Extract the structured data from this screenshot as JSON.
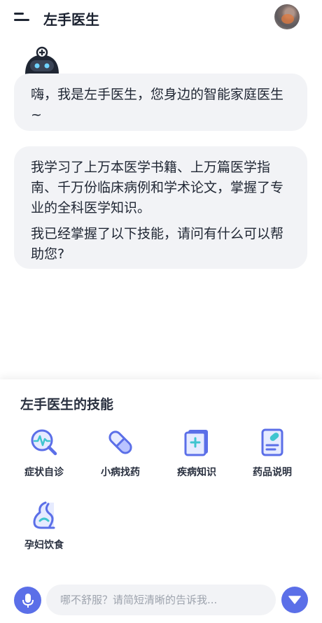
{
  "header": {
    "title": "左手医生",
    "menu_icon": "menu-icon",
    "avatar_icon": "user-avatar"
  },
  "chat": {
    "bot_icon": "robot-doctor-icon",
    "messages": [
      {
        "paragraphs": [
          "嗨，我是左手医生，您身边的智能家庭医生~"
        ]
      },
      {
        "paragraphs": [
          "我学习了上万本医学书籍、上万篇医学指南、千万份临床病例和学术论文，掌握了专业的全科医学知识。",
          "我已经掌握了以下技能，请问有什么可以帮助您?"
        ]
      }
    ]
  },
  "skills": {
    "title": "左手医生的技能",
    "items": [
      {
        "label": "症状自诊",
        "icon": "symptom-search-icon"
      },
      {
        "label": "小病找药",
        "icon": "pill-capsule-icon"
      },
      {
        "label": "疾病知识",
        "icon": "medical-book-icon"
      },
      {
        "label": "药品说明",
        "icon": "medicine-document-icon"
      },
      {
        "label": "孕妇饮食",
        "icon": "pregnancy-icon"
      }
    ]
  },
  "input": {
    "placeholder": "哪不舒服？请简短清晰的告诉我...",
    "value": "",
    "mic_icon": "microphone-icon",
    "send_icon": "expand-down-icon"
  },
  "colors": {
    "accent": "#5b6fe8",
    "bubble": "#f2f3f6",
    "text": "#1f2633"
  }
}
